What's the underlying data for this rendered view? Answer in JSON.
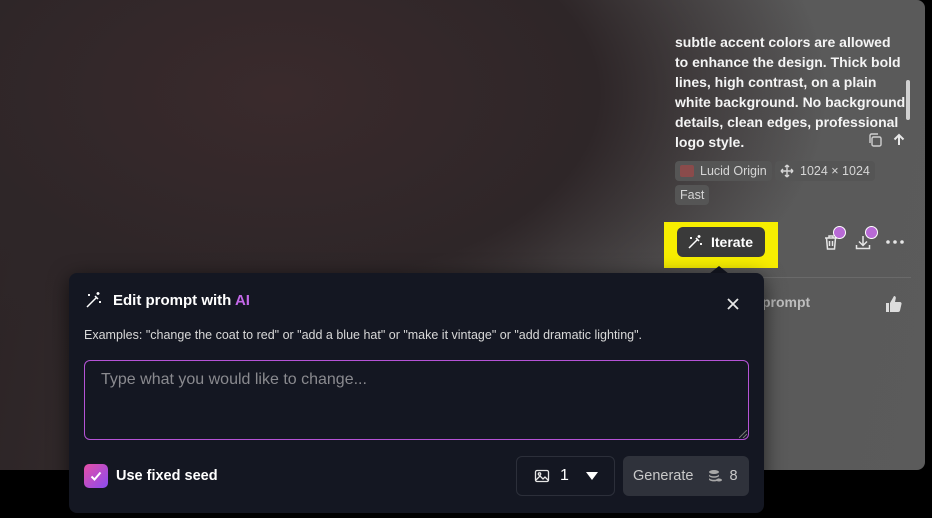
{
  "result_panel": {
    "prompt_text": "subtle accent colors are allowed to enhance the design. Thick bold lines, high contrast, on a plain white background. No background details, clean edges, professional logo style.",
    "model_tag": "Lucid Origin",
    "size_tag": "1024 × 1024",
    "speed_tag": "Fast",
    "iterate_label": "Iterate",
    "behind_text": "prompt",
    "premium_badge_color": "#b86ad6"
  },
  "popover": {
    "title_prefix": "Edit prompt with ",
    "title_ai": "AI",
    "examples": "Examples: \"change the coat to red\" or \"add a blue hat\" or \"make it vintage\" or \"add dramatic lighting\".",
    "input_placeholder": "Type what you would like to change...",
    "input_value": "",
    "seed_label": "Use fixed seed",
    "seed_checked": true,
    "image_count": "1",
    "generate_label": "Generate",
    "generate_cost": "8"
  },
  "colors": {
    "accent_purple": "#b553d6",
    "highlight_yellow": "#f7ee00",
    "popover_bg": "#141722"
  }
}
